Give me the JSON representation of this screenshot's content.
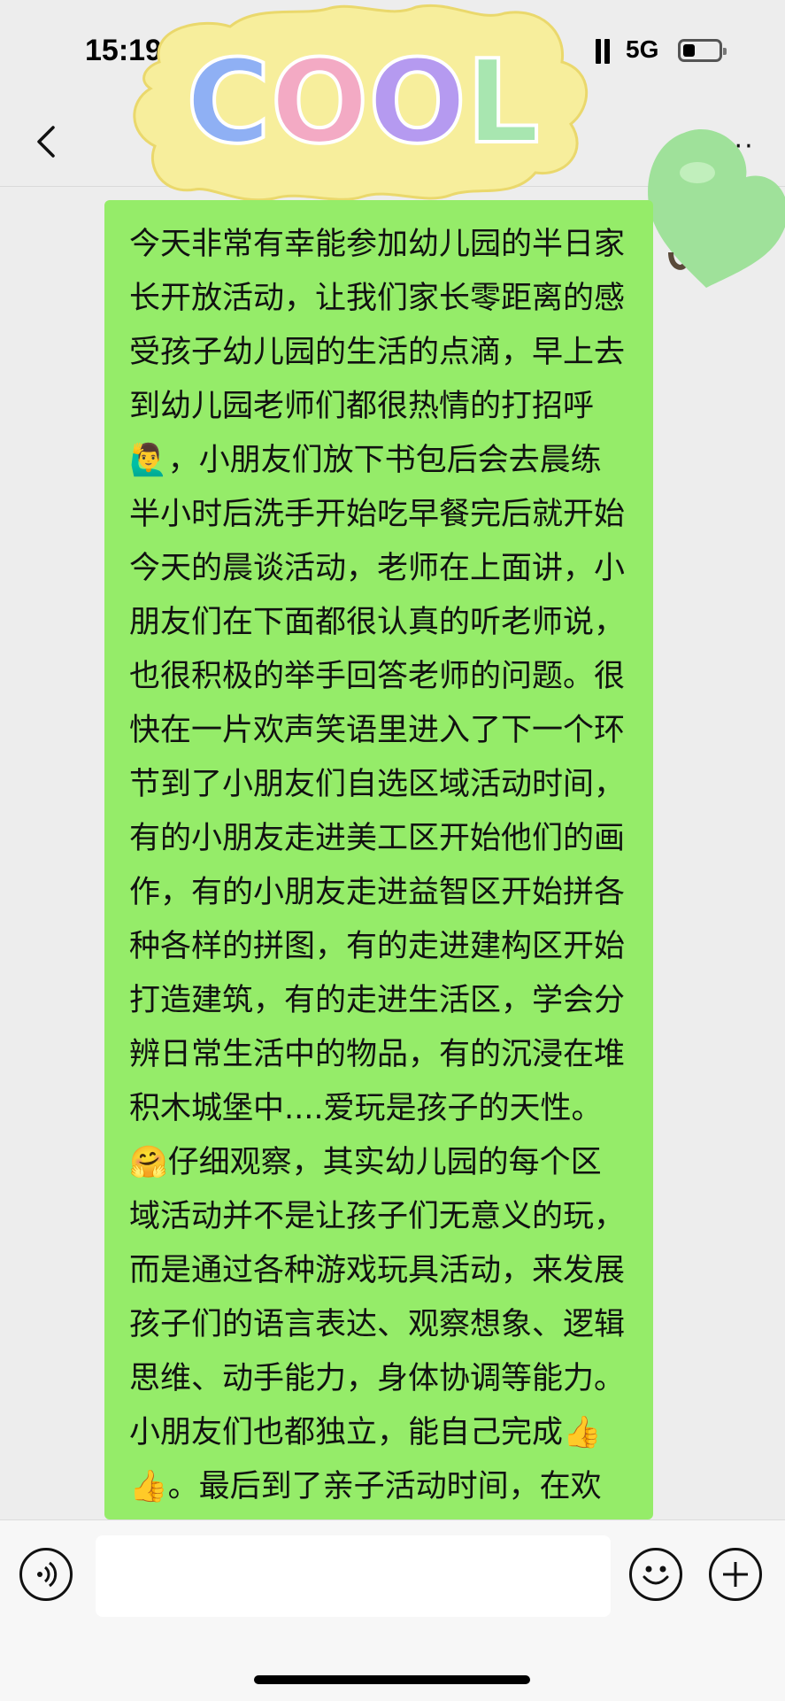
{
  "status_bar": {
    "time": "15:19",
    "network": "5G",
    "battery_level": 0.35,
    "icons": [
      "signal-icon",
      "battery-icon"
    ]
  },
  "nav": {
    "icons": [
      "back-icon",
      "more-icon"
    ],
    "more_label": "···"
  },
  "stickers": {
    "cool_text": "COOL",
    "cool_letter_colors": [
      "#8fb0f4",
      "#f3aac4",
      "#b59af0",
      "#a8e6b0"
    ],
    "cool_blob_color": "#f7ee9c",
    "heart_color": "#9fe19a"
  },
  "message": {
    "bubble_color": "#95ec69",
    "text": "今天非常有幸能参加幼儿园的半日家长开放活动，让我们家长零距离的感受孩子幼儿园的生活的点滴，早上去到幼儿园老师们都很热情的打招呼🙋‍♂️，小朋友们放下书包后会去晨练半小时后洗手开始吃早餐完后就开始今天的晨谈活动，老师在上面讲，小朋友们在下面都很认真的听老师说，也很积极的举手回答老师的问题。很快在一片欢声笑语里进入了下一个环节到了小朋友们自选区域活动时间，有的小朋友走进美工区开始他们的画作，有的小朋友走进益智区开始拼各种各样的拼图，有的走进建构区开始打造建筑，有的走进生活区，学会分辨日常生活中的物品，有的沉浸在堆积木城堡中....爱玩是孩子的天性。🤗仔细观察，其实幼儿园的每个区域活动并不是让孩子们无意义的玩，而是通过各种游戏玩具活动，来发展孩子们的语言表达、观察想象、逻辑思维、动手能力，身体协调等能力。小朋友们也都独立，能自己完成👍👍。最后到了亲子活动时间，在欢乐的歌声里一起跳跳，跑跑爬爬，家长和小朋友都玩的很开心，真真切切体验了上幼儿园的乐趣😁😁"
  },
  "input_bar": {
    "icons": [
      "voice-icon",
      "emoji-icon",
      "plus-icon"
    ],
    "input_value": ""
  }
}
